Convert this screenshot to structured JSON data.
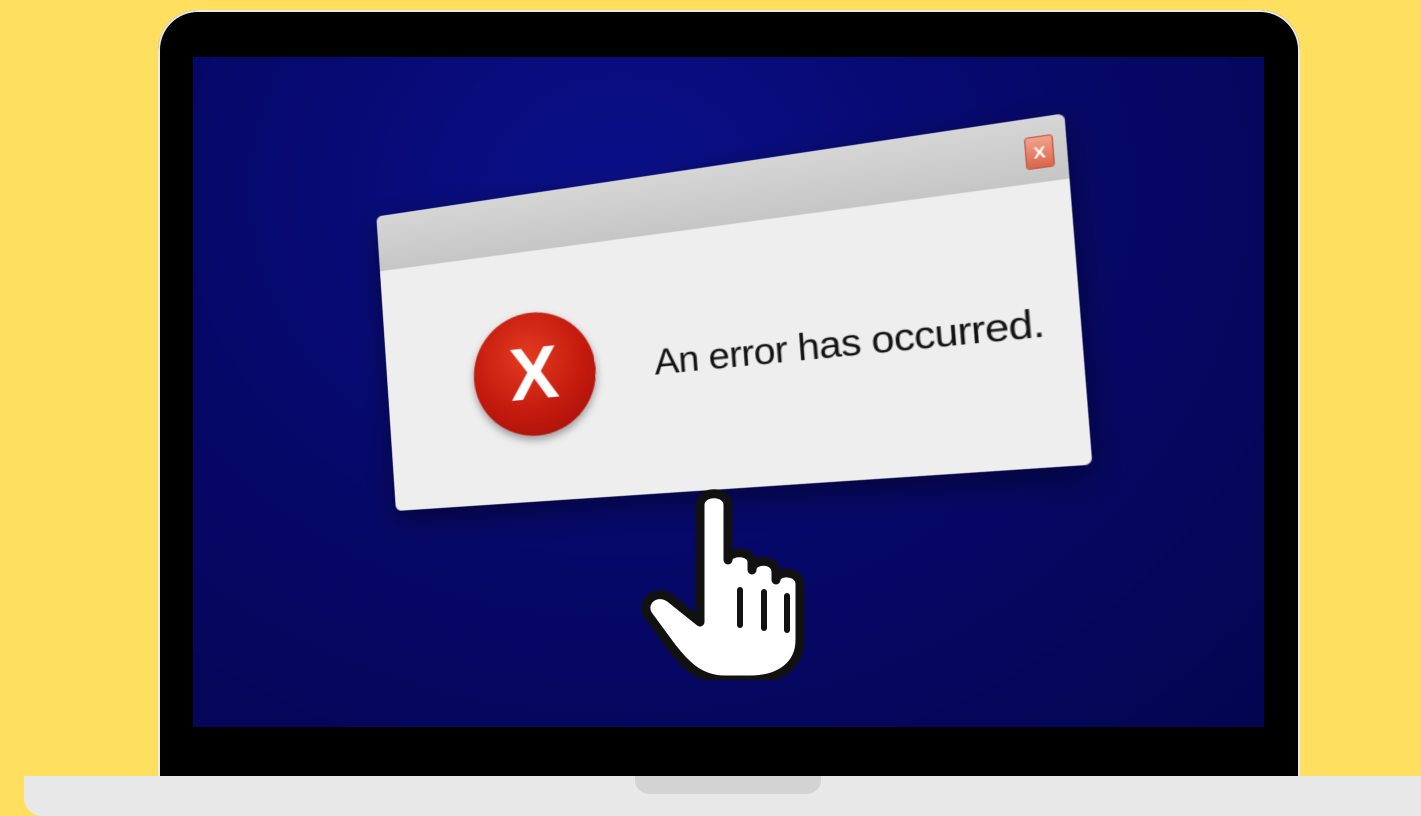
{
  "dialog": {
    "close_label": "X",
    "message": "An error has occurred.",
    "error_icon_glyph": "X",
    "icons": {
      "close": "close-icon",
      "error": "error-icon",
      "cursor": "hand-pointer-cursor-icon"
    }
  },
  "colors": {
    "background": "#FFDF60",
    "screen": "#06086b",
    "error_red": "#c41a0e"
  }
}
